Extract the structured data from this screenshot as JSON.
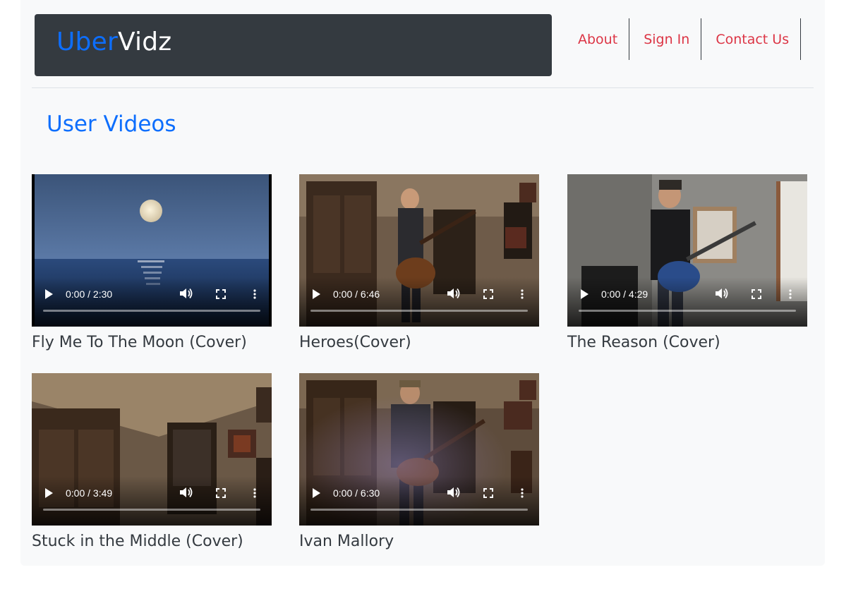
{
  "brand": {
    "part1": "Uber",
    "part2": "Vidz"
  },
  "nav": {
    "about": "About",
    "sign_in": "Sign In",
    "contact": "Contact Us"
  },
  "section_title": "User Videos",
  "colors": {
    "brand_blue": "#0d6efd",
    "nav_red": "#dc3545",
    "dark_bar": "#343a40"
  },
  "videos": [
    {
      "title": "Fly Me To The Moon (Cover)",
      "time": "0:00 / 2:30"
    },
    {
      "title": "Heroes(Cover)",
      "time": "0:00 / 6:46"
    },
    {
      "title": "The Reason (Cover)",
      "time": "0:00 / 4:29"
    },
    {
      "title": "Stuck in the Middle (Cover)",
      "time": "0:00 / 3:49"
    },
    {
      "title": "Ivan Mallory",
      "time": "0:00 / 6:30"
    }
  ],
  "icons": {
    "play": "play-icon",
    "volume": "volume-icon",
    "fullscreen": "fullscreen-icon",
    "more": "more-options-icon"
  }
}
